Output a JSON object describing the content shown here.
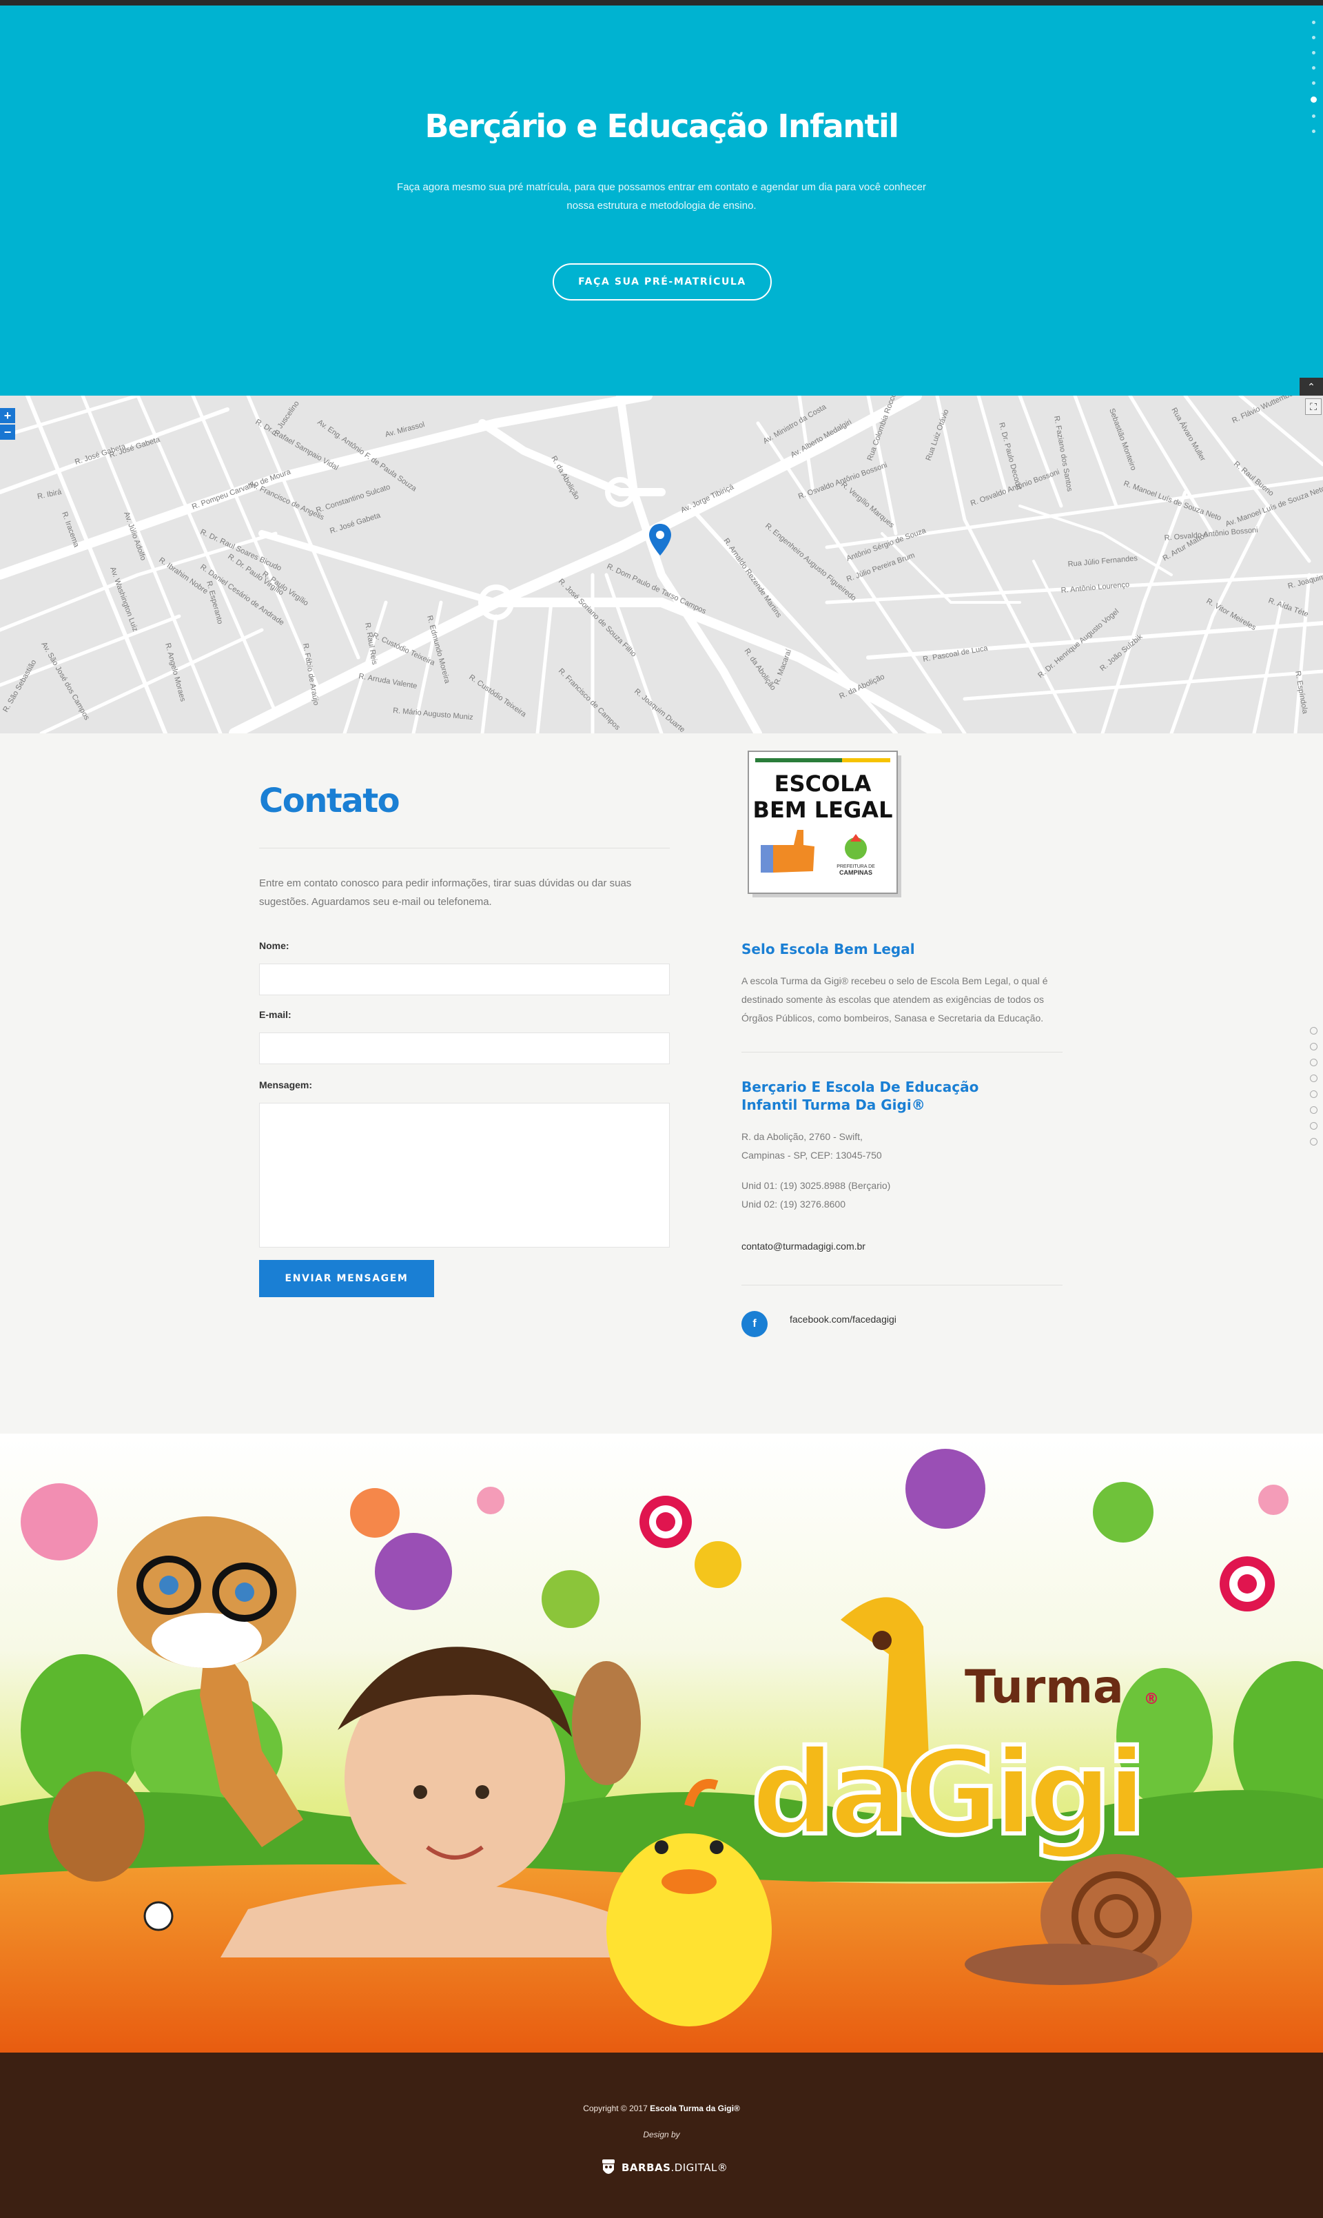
{
  "hero": {
    "title": "Berçário e Educação Infantil",
    "text": "Faça agora mesmo sua pré matrícula, para que possamos entrar em contato e agendar um dia para você conhecer nossa estrutura e metodologia de ensino.",
    "cta_label": "FAÇA SUA PRÉ-MATRÍCULA"
  },
  "map": {
    "zoom_in_label": "+",
    "zoom_out_label": "−",
    "fullscreen_label": "⛶",
    "streets": [
      "R. José Gabeta",
      "R. José Gabeta",
      "R. Ibirá",
      "R. Juscelino",
      "Av. Eng. Antônio F. de Paula Souza",
      "R. Dr. Rafael Sampaio Vidal",
      "Av. Mirassol",
      "R. da Abolição",
      "Av. Ministro da Costa",
      "Av. Alberto Medalgiri",
      "Rua Colombia Rocco",
      "Rua Luiz Otávio",
      "R. Dr. Paulo Decourt",
      "R. Faziano dos Santos",
      "Sebastião Monteiro",
      "Rua Álvaro Muller",
      "R. Flávio Wuttemberg",
      "R. Constantino Sulcato",
      "R. Pompeu Carvalho de Moura",
      "R. Dr. Raul Soares Bicudo",
      "Av. Francisco de Angelis",
      "R. José Gabeta",
      "Av. Jorge Tibiriçá",
      "R. Osvaldo Antônio Bossoni",
      "R. Vergílio Marques",
      "R. Osvaldo Antônio Bossoni",
      "R. Manoel Luís de Souza Neto",
      "R. Osvaldo Antônio Bossoni",
      "Av. Manoel Luís de Souza Neto",
      "R. Ibrahim Nobre",
      "R. Daniel Cesário de Andrade",
      "R. Paulo Virgílio",
      "R. Dr. Paulo Virgílio",
      "R. Dom Paulo de Tarso Campos",
      "R. José Soriano de Souza Filho",
      "R. Arnaldo Rezende Martins",
      "R. Engenheiro Augusto Figueiredo",
      "Antônio Sérgio de Souza",
      "R. Júlio Pereira Brum",
      "Rua Júlio Fernandes",
      "R. Artur Mattos",
      "R. Antônio Lourenço",
      "R. Vitor Meireles",
      "R. Aída Téte",
      "R. Joaquim",
      "R. Pascoal de Luca",
      "R. Dr. Henrique Augusto Vogel",
      "R. João Sulzbik",
      "R. da Abolição",
      "R. da Abolição",
      "R. Macaraí",
      "R. Joaquim Duarte",
      "R. Francisco de Campos",
      "R. Custódio Teixeira",
      "R. Arruda Valente",
      "R. Mário Augusto Muniz",
      "R. Custódio Teixeira",
      "R. Edmundo Moreira",
      "R. Raul Reis",
      "R. Fábio de Araújo",
      "Av. Washington Luiz",
      "Av. Júlio Adolfo",
      "R. Esperanto",
      "R. Iracema",
      "Av. São José dos Campos",
      "R. São Sebastião",
      "R. Angelo Moraes",
      "R. Raul Bueno",
      "R. Espíndola"
    ]
  },
  "contact": {
    "title": "Contato",
    "intro": "Entre em contato conosco para pedir informações, tirar suas dúvidas ou dar suas sugestões. Aguardamos seu e-mail ou telefonema.",
    "name_label": "Nome:",
    "name_value": "",
    "email_label": "E-mail:",
    "email_value": "",
    "message_label": "Mensagem:",
    "message_value": "",
    "submit_label": "ENVIAR MENSAGEM"
  },
  "badge": {
    "line1": "ESCOLA",
    "line2": "BEM LEGAL",
    "prefeitura": "PREFEITURA DE",
    "city": "CAMPINAS"
  },
  "seal": {
    "title": "Selo Escola Bem Legal",
    "text": "A escola Turma da Gigi® recebeu o selo de Escola Bem Legal, o qual é destinado somente às escolas que atendem as exigências de todos os Órgãos Públicos, como bombeiros, Sanasa e Secretaria da Educação."
  },
  "school": {
    "title": "Berçario E Escola De Educação Infantil Turma Da Gigi®",
    "address_line1": "R. da Abolição, 2760 - Swift,",
    "address_line2": "Campinas - SP, CEP: 13045-750",
    "phone1": "Unid 01: (19) 3025.8988 (Berçario)",
    "phone2": "Unid 02: (19) 3276.8600",
    "email": "contato@turmadagigi.com.br",
    "facebook_icon_label": "f",
    "facebook": "facebook.com/facedagigi"
  },
  "art": {
    "logo_word1": "Turma",
    "logo_reg": "®",
    "logo_word2": "daGigi"
  },
  "footer": {
    "copyright": "Copyright © 2017",
    "school_name": "Escola Turma da Gigi®",
    "design_by": "Design by",
    "agency_bold": "BARBAS",
    "agency_rest": ".DIGITAL®"
  },
  "colors": {
    "hero_bg": "#00b3d1",
    "accent_blue": "#1a7fd4",
    "footer_bg": "#3c2012",
    "page_bg": "#f5f5f3",
    "map_bg": "#e6e6e6"
  },
  "icons": {
    "scroll_top": "chevron-up-icon",
    "facebook": "facebook-icon",
    "map_pin": "map-pin-icon",
    "fullscreen": "fullscreen-icon"
  }
}
